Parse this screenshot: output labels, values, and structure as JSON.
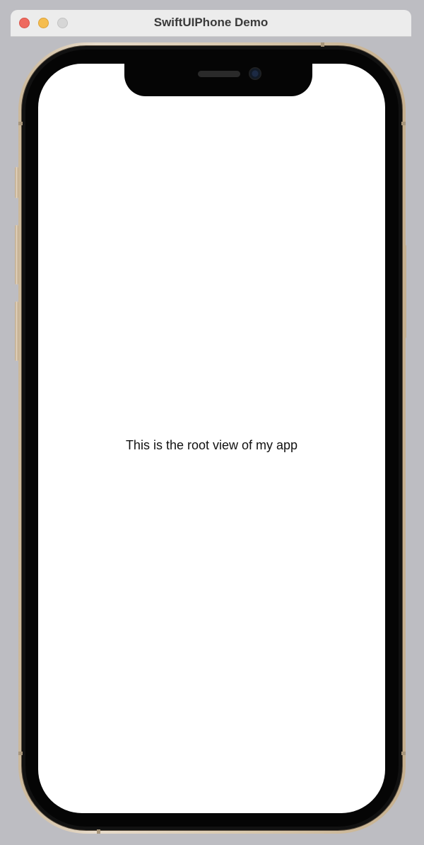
{
  "window": {
    "title": "SwiftUIPhone Demo",
    "controls": {
      "close": "close-button",
      "minimize": "minimize-button",
      "zoom": "zoom-button"
    }
  },
  "app": {
    "root_text": "This is the root view of my app"
  },
  "colors": {
    "background": "#bdbdc2",
    "frame_gold": "#d8c8ad",
    "screen": "#ffffff",
    "close": "#ee6a5f",
    "minimize": "#f5bd4f",
    "zoom": "#d6d6d6"
  }
}
